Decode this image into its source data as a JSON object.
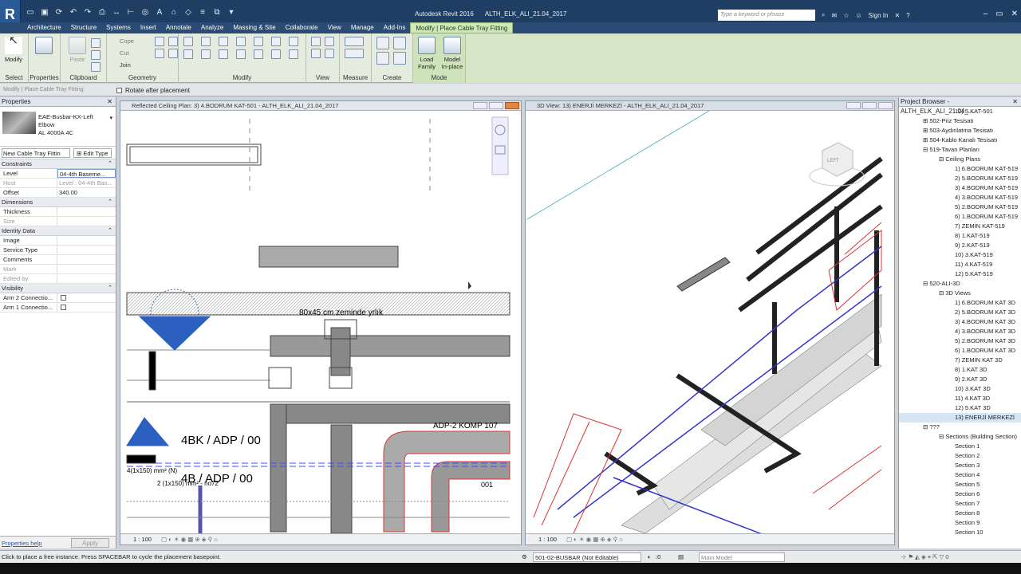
{
  "app": {
    "title": "Autodesk Revit 2016",
    "file": "ALTH_ELK_ALI_21.04_2017",
    "search_placeholder": "Type a keyword or phrase",
    "sign_in": "Sign In"
  },
  "tabs": [
    "Architecture",
    "Structure",
    "Systems",
    "Insert",
    "Annotate",
    "Analyze",
    "Massing & Site",
    "Collaborate",
    "View",
    "Manage",
    "Add-Ins",
    "Modify | Place Cable Tray Fitting"
  ],
  "ribbon": {
    "select_label": "Select",
    "modify_label": "Modify",
    "properties_label": "Properties",
    "paste_label": "Paste",
    "clipboard_label": "Clipboard",
    "cope_label": "Cope",
    "cut_label": "Cut",
    "join_label": "Join",
    "geometry_label": "Geometry",
    "modify_panel_label": "Modify",
    "view_label": "View",
    "measure_label": "Measure",
    "create_label": "Create",
    "load_family_1": "Load",
    "load_family_2": "Family",
    "model_inplace_1": "Model",
    "model_inplace_2": "In-place",
    "mode_label": "Mode"
  },
  "options_bar": {
    "context": "Modify | Place Cable Tray Fitting",
    "rotate_label": "Rotate after placement"
  },
  "properties": {
    "title": "Properties",
    "type_line1": "EAE-Busbar-KX-Left",
    "type_line2": "Elbow",
    "type_line3": "AL 4000A 4C",
    "instance_selector": "New Cable Tray Fittin",
    "edit_type": "Edit Type",
    "sections": {
      "constraints": "Constraints",
      "dimensions": "Dimensions",
      "identity": "Identity Data",
      "visibility": "Visibility"
    },
    "constraints_rows": [
      {
        "k": "Level",
        "v": "04-4th Baseme..."
      },
      {
        "k": "Host",
        "v": "Level : 04-4th Bas..."
      },
      {
        "k": "Offset",
        "v": "340.00"
      }
    ],
    "dimensions_rows": [
      {
        "k": "Thickness",
        "v": ""
      },
      {
        "k": "Size",
        "v": ""
      }
    ],
    "identity_rows": [
      {
        "k": "Image",
        "v": ""
      },
      {
        "k": "Service Type",
        "v": ""
      },
      {
        "k": "Comments",
        "v": ""
      },
      {
        "k": "Mark",
        "v": ""
      },
      {
        "k": "Edited by",
        "v": ""
      }
    ],
    "visibility_rows": [
      {
        "k": "Arm 2 Connectio...",
        "v": ""
      },
      {
        "k": "Arm 1 Connectio...",
        "v": ""
      }
    ],
    "help": "Properties help",
    "apply": "Apply"
  },
  "view1": {
    "title": "Reflected Ceiling Plan: 3) 4.BODRUM KAT-501 - ALTH_ELK_ALI_21.04_2017",
    "scale": "1 : 100",
    "annotation1": "80x45 cm zeminde yrlık",
    "annotation2": "4BK / ADP / 00",
    "annotation3": "4B / ADP / 00",
    "annotation4": "ADP-2 KOMP 107",
    "annotation5": "4(1x150) mm² (N)",
    "annotation6": "2 (1x150) mm² - no72",
    "annotation7": "001"
  },
  "view2": {
    "title": "3D View: 13) ENERJİ MERKEZİ - ALTH_ELK_ALI_21.04_2017",
    "scale": "1 : 100",
    "cube_label": "LEFT"
  },
  "browser": {
    "title": "Project Browser - ALTH_ELK_ALI_21.04_...",
    "items": [
      {
        "t": "12) 5.KAT-501",
        "i": 7
      },
      {
        "t": "502-Priz Tesisatı",
        "i": 3,
        "exp": "+"
      },
      {
        "t": "503-Aydınlatma Tesisatı",
        "i": 3,
        "exp": "+"
      },
      {
        "t": "504-Kablo Kanalı Tesisatı",
        "i": 3,
        "exp": "+"
      },
      {
        "t": "519-Tavan Planları",
        "i": 3,
        "exp": "-"
      },
      {
        "t": "Ceiling Plans",
        "i": 5,
        "exp": "-"
      },
      {
        "t": "1) 6.BODRUM KAT-519",
        "i": 7
      },
      {
        "t": "2) 5.BODRUM KAT-519",
        "i": 7
      },
      {
        "t": "3) 4.BODRUM KAT-519",
        "i": 7
      },
      {
        "t": "4) 3.BODRUM KAT-519",
        "i": 7
      },
      {
        "t": "5) 2.BODRUM KAT-519",
        "i": 7
      },
      {
        "t": "6) 1.BODRUM KAT-519",
        "i": 7
      },
      {
        "t": "7) ZEMİN KAT-519",
        "i": 7
      },
      {
        "t": "8) 1.KAT-519",
        "i": 7
      },
      {
        "t": "9) 2.KAT-519",
        "i": 7
      },
      {
        "t": "10) 3.KAT-519",
        "i": 7
      },
      {
        "t": "11) 4.KAT-519",
        "i": 7
      },
      {
        "t": "12) 5.KAT-519",
        "i": 7
      },
      {
        "t": "520-ALI-3D",
        "i": 3,
        "exp": "-"
      },
      {
        "t": "3D Views",
        "i": 5,
        "exp": "-"
      },
      {
        "t": "1) 6.BODRUM KAT 3D",
        "i": 7
      },
      {
        "t": "2) 5.BODRUM KAT 3D",
        "i": 7
      },
      {
        "t": "3) 4.BODRUM KAT 3D",
        "i": 7
      },
      {
        "t": "4) 3.BODRUM KAT 3D",
        "i": 7
      },
      {
        "t": "5) 2.BODRUM KAT 3D",
        "i": 7
      },
      {
        "t": "6) 1.BODRUM KAT 3D",
        "i": 7
      },
      {
        "t": "7) ZEMİN KAT 3D",
        "i": 7
      },
      {
        "t": "8) 1.KAT 3D",
        "i": 7
      },
      {
        "t": "9) 2.KAT 3D",
        "i": 7
      },
      {
        "t": "10) 3.KAT 3D",
        "i": 7
      },
      {
        "t": "11) 4.KAT 3D",
        "i": 7
      },
      {
        "t": "12) 5.KAT 3D",
        "i": 7
      },
      {
        "t": "13) ENERJİ MERKEZİ",
        "i": 7,
        "sel": true
      },
      {
        "t": "???",
        "i": 3,
        "exp": "-"
      },
      {
        "t": "Sections (Building Section)",
        "i": 5,
        "exp": "-"
      },
      {
        "t": "Section 1",
        "i": 7
      },
      {
        "t": "Section 2",
        "i": 7
      },
      {
        "t": "Section 3",
        "i": 7
      },
      {
        "t": "Section 4",
        "i": 7
      },
      {
        "t": "Section 5",
        "i": 7
      },
      {
        "t": "Section 6",
        "i": 7
      },
      {
        "t": "Section 7",
        "i": 7
      },
      {
        "t": "Section 8",
        "i": 7
      },
      {
        "t": "Section 9",
        "i": 7
      },
      {
        "t": "Section 10",
        "i": 7
      }
    ]
  },
  "status": {
    "message": "Click to place a free instance. Press SPACEBAR to cycle the placement basepoint.",
    "workset": "501-02-BUSBAR (Not Editable)",
    "counter": ":0",
    "main_model": "Main Model"
  },
  "colors": {
    "accent": "#cfe8b9",
    "title_bar": "#1f3e63",
    "selection": "#d6e4f4"
  }
}
